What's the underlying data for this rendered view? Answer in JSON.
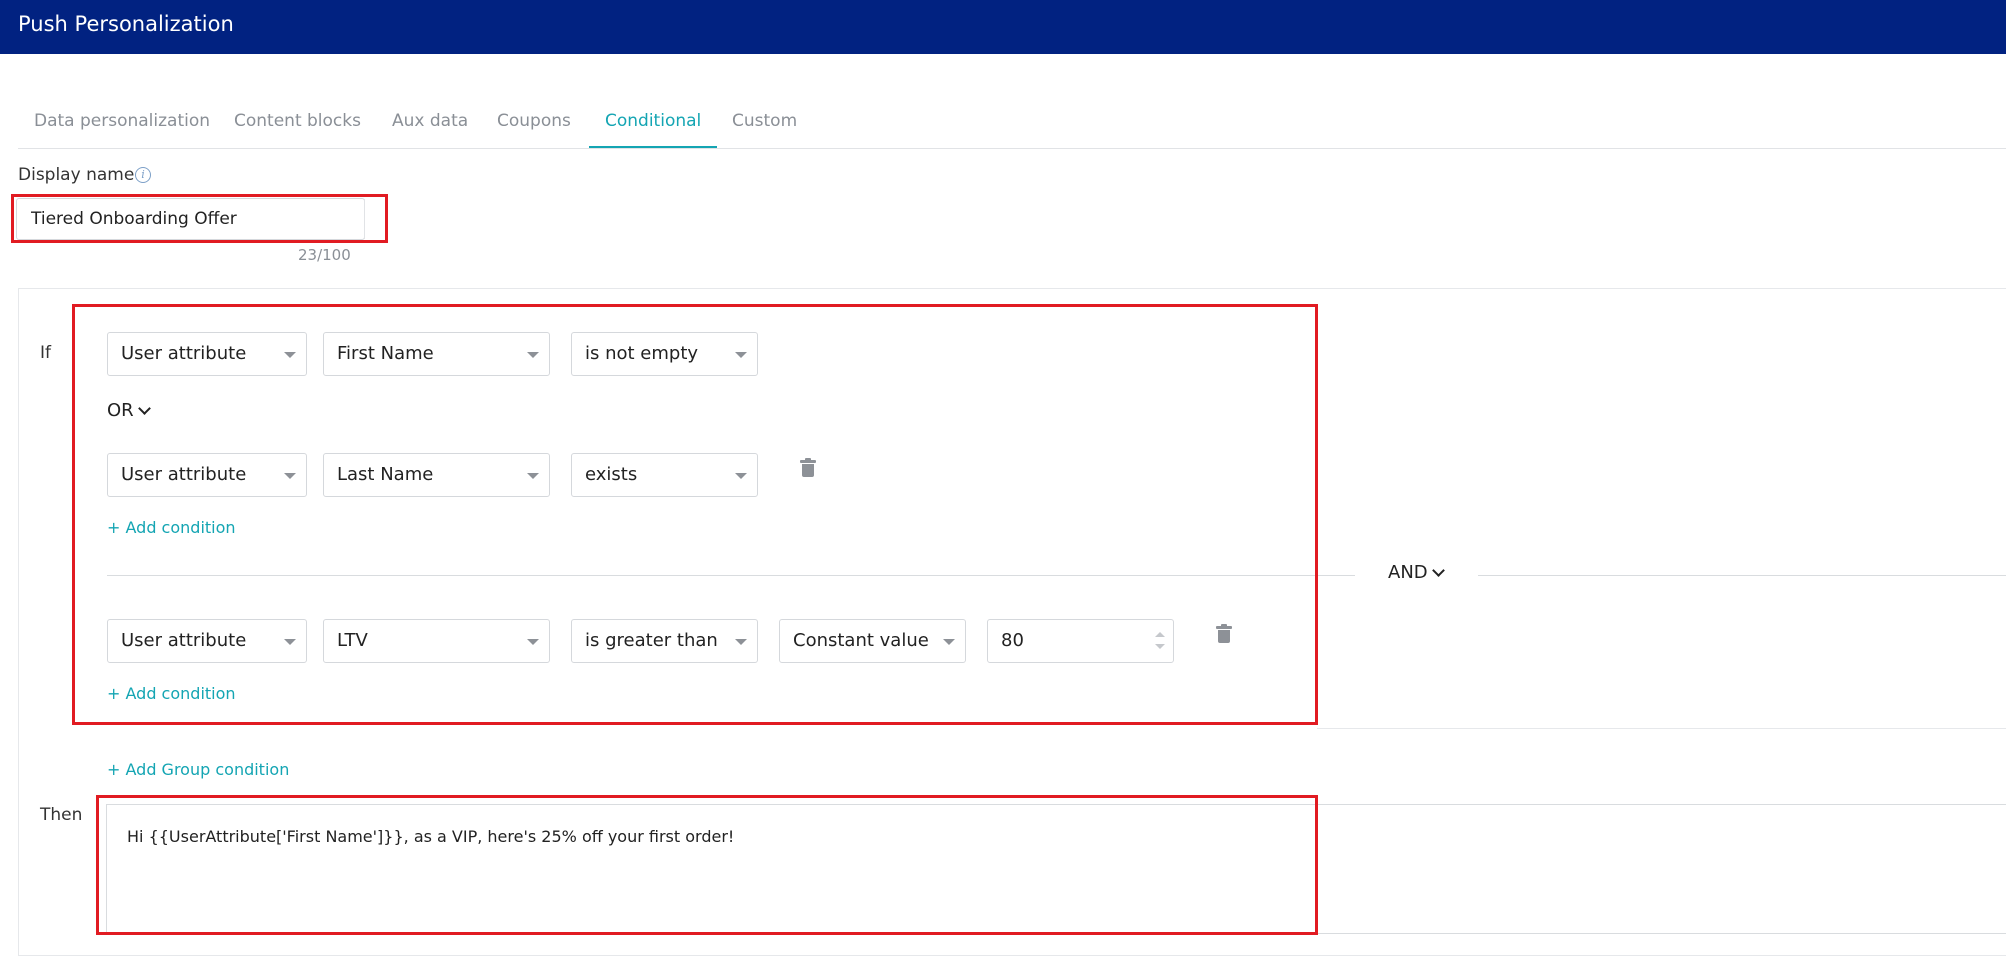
{
  "header": {
    "title": "Push Personalization"
  },
  "tabs": [
    {
      "label": "Data personalization"
    },
    {
      "label": "Content blocks"
    },
    {
      "label": "Aux data"
    },
    {
      "label": "Coupons"
    },
    {
      "label": "Conditional",
      "active": true
    },
    {
      "label": "Custom"
    }
  ],
  "display_name": {
    "label": "Display name",
    "value": "Tiered Onboarding Offer",
    "counter": "23/100"
  },
  "if_label": "If",
  "then_label": "Then",
  "group": {
    "conditions": [
      {
        "source": "User attribute",
        "attribute": "First Name",
        "operator": "is not empty"
      },
      {
        "source": "User attribute",
        "attribute": "Last Name",
        "operator": "exists"
      }
    ],
    "connector": "OR",
    "add_condition": "+ Add condition"
  },
  "group_connector": "AND",
  "group2": {
    "condition": {
      "source": "User attribute",
      "attribute": "LTV",
      "operator": "is greater than",
      "value_type": "Constant value",
      "value": "80"
    },
    "add_condition": "+ Add condition"
  },
  "add_group_condition": "+ Add Group condition",
  "then_text": "Hi {{UserAttribute['First Name']}}, as a VIP, here's 25% off your first order!",
  "colors": {
    "header_bg": "#012281",
    "accent": "#14a5b3",
    "highlight": "#e11b22"
  }
}
